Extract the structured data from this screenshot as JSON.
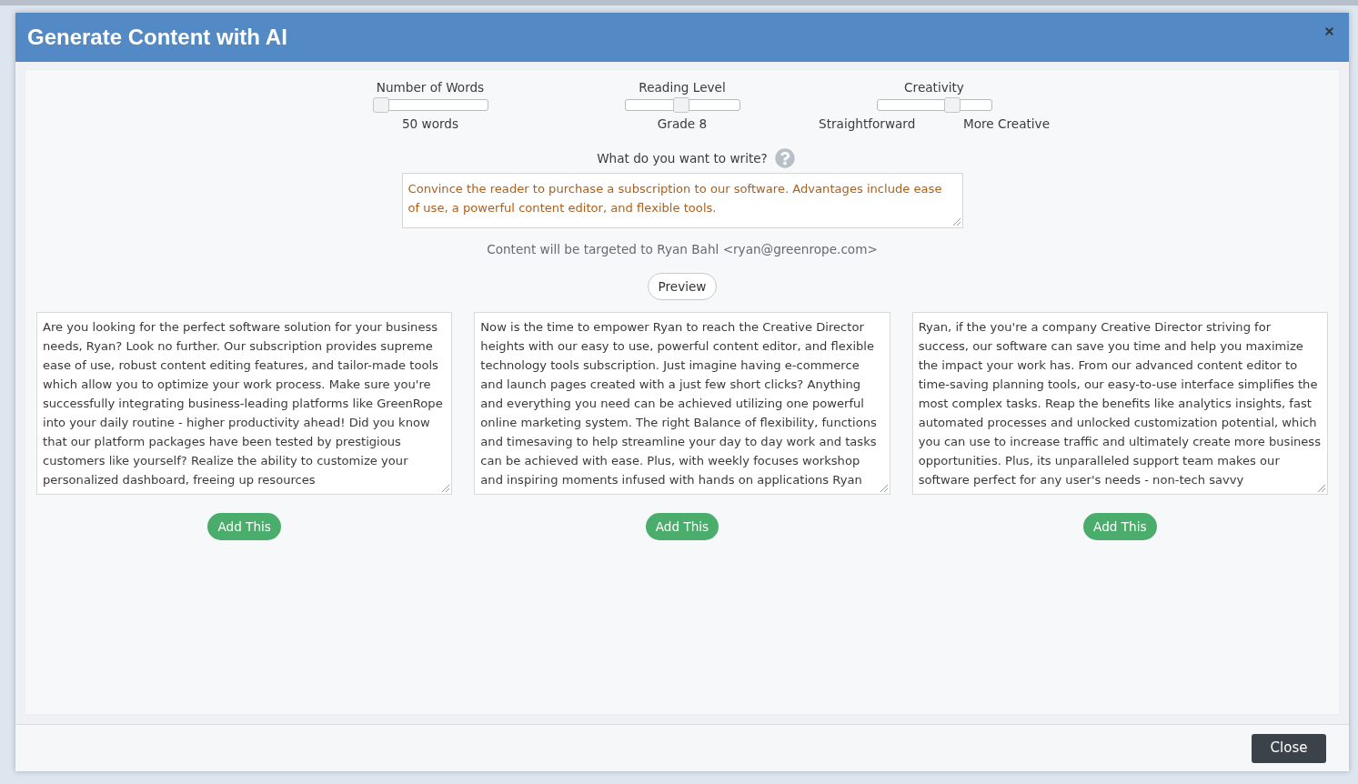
{
  "dialog": {
    "title": "Generate Content with AI"
  },
  "sliders": [
    {
      "label": "Number of Words",
      "level": 0,
      "readings": [
        "50 words"
      ]
    },
    {
      "label": "Reading Level",
      "level": 0.5,
      "readings": [
        "Grade 8"
      ]
    },
    {
      "label": "Creativity",
      "level": 0.7,
      "readings": [
        "Straightforward",
        "More Creative"
      ]
    }
  ],
  "prompt": {
    "label": "What do you want to write?",
    "value": "Convince the reader to purchase a subscription to our software. Advantages include ease of use, a powerful content editor, and flexible tools."
  },
  "target_note": "Content will be targeted to Ryan Bahl <ryan@greenrope.com>",
  "preview_button": "Preview",
  "results": [
    {
      "text": "Are you looking for the perfect software solution for your business needs, Ryan? Look no further. Our subscription provides supreme ease of use, robust content editing features, and tailor-made tools which allow you to optimize your work process. Make sure you're successfully integrating business-leading platforms like GreenRope into your daily routine - higher productivity ahead! Did you know that our platform packages have been tested by prestigious customers like yourself? Realize the ability to customize your personalized dashboard, freeing up resources",
      "button": "Add This"
    },
    {
      "text": "Now is the time to empower Ryan to reach the Creative Director heights with our easy to use, powerful content editor, and flexible technology tools subscription. Just imagine having e-commerce and launch pages created with a just few short clicks? Anything and everything you need can be achieved utilizing one powerful online marketing system. The right Balance of flexibility, functions and timesaving to help streamline your day to day work and tasks can be achieved with ease. Plus, with weekly focuses workshop and inspiring moments infused with hands on applications Ryan",
      "button": "Add This"
    },
    {
      "text": "Ryan, if the you're a company Creative Director striving for success, our software can save you time and help you maximize the impact your work has. From our advanced content editor to time-saving planning tools, our easy-to-use interface simplifies the most complex tasks. Reap the benefits like analytics insights, fast automated processes and unlocked customization potential, which you can use to increase traffic and ultimately create more business opportunities. Plus, its unparalleled support team makes our software perfect for any user's needs - non-tech savvy",
      "button": "Add This"
    }
  ],
  "footer": {
    "close_button": "Close"
  }
}
